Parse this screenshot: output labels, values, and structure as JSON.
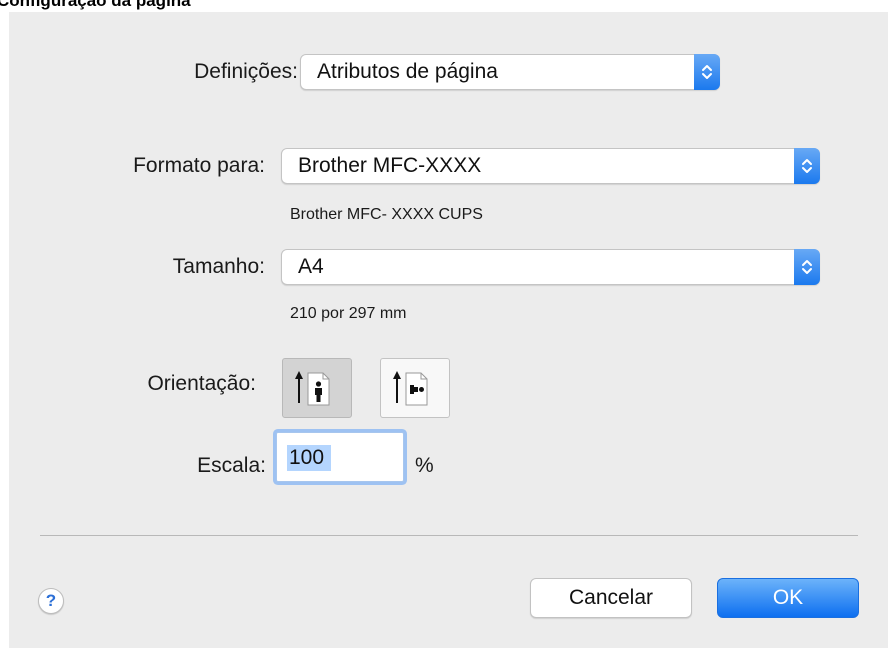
{
  "page": {
    "caption": "Configuração da página"
  },
  "dialog": {
    "settings": {
      "label": "Definições:",
      "value": "Atributos de página"
    },
    "format_for": {
      "label": "Formato para:",
      "value": "Brother MFC-XXXX",
      "subtext": "Brother MFC- XXXX CUPS"
    },
    "paper_size": {
      "label": "Tamanho:",
      "value": "A4",
      "subtext": "210 por 297 mm"
    },
    "orientation": {
      "label": "Orientação:",
      "options": [
        "portrait",
        "landscape"
      ],
      "selected": "portrait"
    },
    "scale": {
      "label": "Escala:",
      "value": "100",
      "unit": "%"
    },
    "buttons": {
      "help": "?",
      "cancel": "Cancelar",
      "ok": "OK"
    }
  },
  "colors": {
    "accent": "#1b79ee",
    "dialog_bg": "#ececec",
    "focus_ring": "#9ec2f2",
    "selection": "#b4d5fe"
  }
}
